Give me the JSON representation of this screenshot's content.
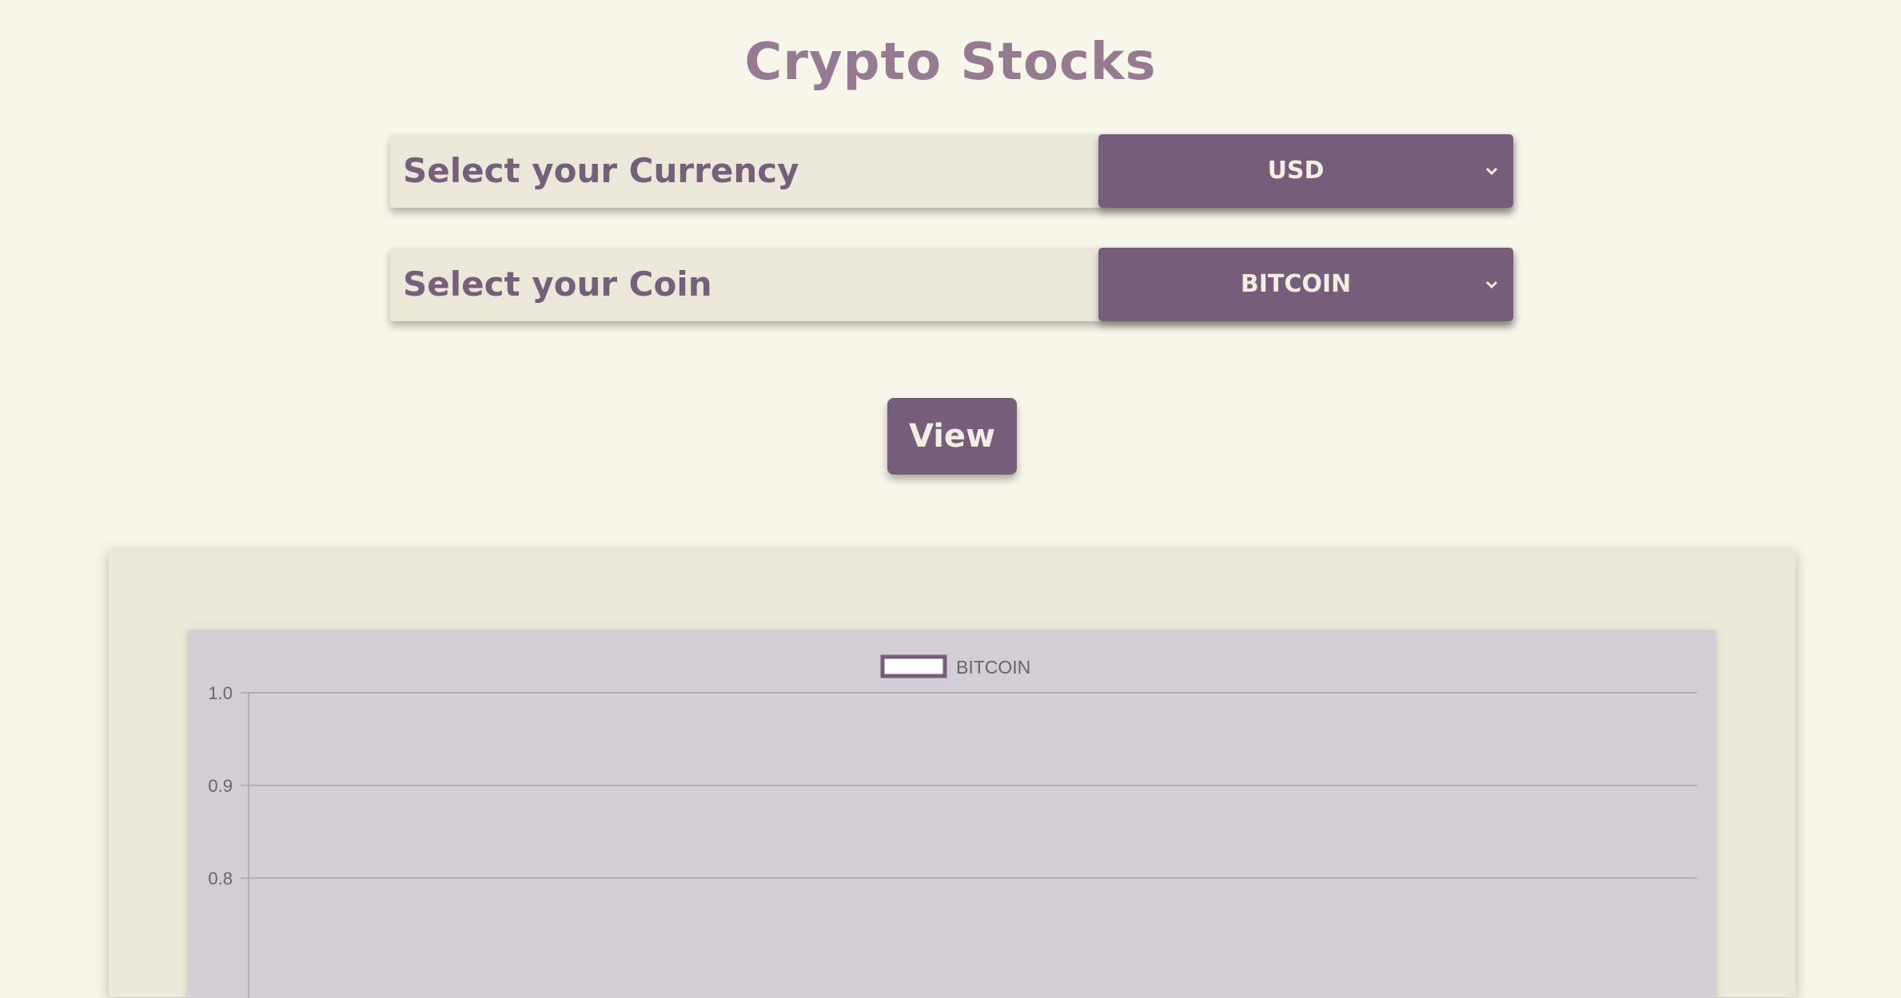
{
  "page": {
    "title": "Crypto Stocks"
  },
  "currency_select": {
    "label": "Select your Currency",
    "value": "USD"
  },
  "coin_select": {
    "label": "Select your Coin",
    "value": "BITCOIN"
  },
  "view_button": {
    "label": "View"
  },
  "colors": {
    "accent": "#765d7a",
    "title": "#957a92",
    "background": "#f8f6ea",
    "panel": "#ebe8d9",
    "chart_bg": "#d3ced6"
  },
  "icons": {
    "select_arrow": "chevron-down-icon"
  },
  "chart_data": {
    "type": "line",
    "legend": [
      "BITCOIN"
    ],
    "legend_position": "top",
    "series": [
      {
        "name": "BITCOIN",
        "values": []
      }
    ],
    "y_ticks": [
      "1.0",
      "0.9",
      "0.8"
    ],
    "ylim": [
      0.8,
      1.0
    ],
    "grid": true
  }
}
